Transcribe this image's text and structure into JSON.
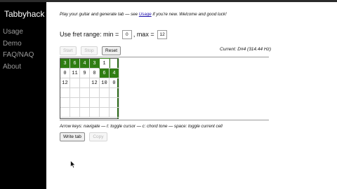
{
  "sidebar": {
    "brand": "Tabbyhack",
    "items": [
      {
        "label": "Usage"
      },
      {
        "label": "Demo"
      },
      {
        "label": "FAQ/NAQ"
      },
      {
        "label": "About"
      }
    ]
  },
  "intro": {
    "prefix": "Play your guitar and generate tab — see ",
    "link": "Usage",
    "suffix": " if you're new. Welcome and good luck!"
  },
  "fret_range": {
    "label_prefix": "Use fret range: min =",
    "min_value": "0",
    "separator": ", max =",
    "max_value": "12"
  },
  "controls": {
    "start": "Start",
    "stop": "Stop",
    "reset": "Reset"
  },
  "current": "Current: D#4 (314.44 Hz)",
  "tab_grid": {
    "rows": [
      [
        "3",
        "6",
        "4",
        "3",
        "1",
        ""
      ],
      [
        "0",
        "11",
        "9",
        "0",
        "6",
        "4"
      ],
      [
        "12",
        "",
        "",
        "12",
        "10",
        "0"
      ],
      [
        "",
        "",
        "",
        "",
        "",
        ""
      ],
      [
        "",
        "",
        "",
        "",
        "",
        ""
      ],
      [
        "",
        "",
        "",
        "",
        "",
        ""
      ]
    ],
    "highlighted": [
      [
        true,
        true,
        true,
        true,
        false,
        false
      ],
      [
        false,
        false,
        false,
        false,
        true,
        true
      ],
      [
        false,
        false,
        false,
        false,
        false,
        false
      ],
      [
        false,
        false,
        false,
        false,
        false,
        false
      ],
      [
        false,
        false,
        false,
        false,
        false,
        false
      ],
      [
        false,
        false,
        false,
        false,
        false,
        false
      ]
    ]
  },
  "hint": "Arrow keys: navigate — t: toggle cursor — c: chord tone — space: toggle current cell",
  "actions": {
    "write_tab": "Write tab",
    "copy": "Copy"
  },
  "icons": {
    "pointer": "mouse-pointer-icon"
  }
}
